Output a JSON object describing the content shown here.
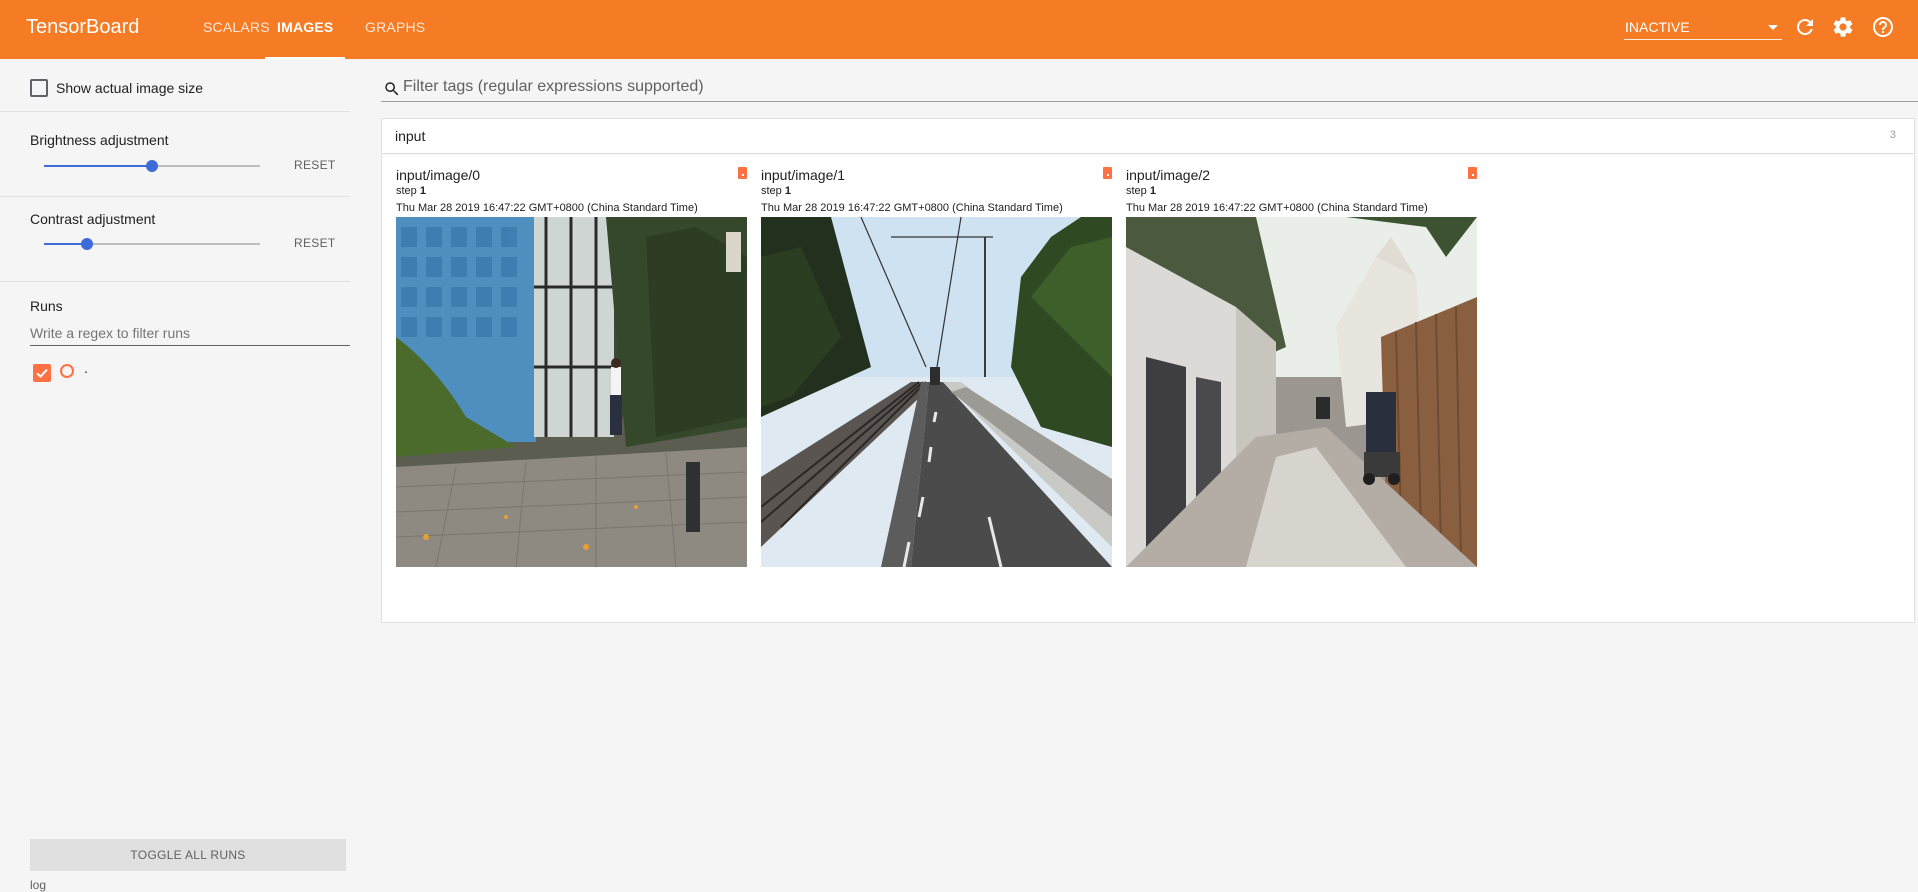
{
  "header": {
    "brand": "TensorBoard",
    "tabs": [
      {
        "label": "SCALARS",
        "active": false
      },
      {
        "label": "IMAGES",
        "active": true
      },
      {
        "label": "GRAPHS",
        "active": false
      }
    ],
    "status": "INACTIVE",
    "icons": [
      "refresh-icon",
      "settings-gear-icon",
      "help-icon"
    ],
    "accent_color": "#f57c24"
  },
  "sidebar": {
    "show_actual_size_label": "Show actual image size",
    "brightness_label": "Brightness adjustment",
    "brightness_value": 0.5,
    "contrast_label": "Contrast adjustment",
    "contrast_value": 0.2,
    "reset_label": "RESET",
    "runs_label": "Runs",
    "runs_filter_placeholder": "Write a regex to filter runs",
    "runs": [
      {
        "name": ".",
        "checked": true,
        "color": "#ff7043"
      }
    ],
    "toggle_all_label": "TOGGLE ALL RUNS",
    "log_dir": "log"
  },
  "main": {
    "filter_placeholder": "Filter tags (regular expressions supported)",
    "category": {
      "name": "input",
      "count": "3"
    },
    "images": [
      {
        "tag": "input/image/0",
        "step_label": "step",
        "step": "1",
        "time": "Thu Mar 28 2019 16:47:22 GMT+0800 (China Standard Time)"
      },
      {
        "tag": "input/image/1",
        "step_label": "step",
        "step": "1",
        "time": "Thu Mar 28 2019 16:47:22 GMT+0800 (China Standard Time)"
      },
      {
        "tag": "input/image/2",
        "step_label": "step",
        "step": "1",
        "time": "Thu Mar 28 2019 16:47:22 GMT+0800 (China Standard Time)"
      }
    ]
  }
}
